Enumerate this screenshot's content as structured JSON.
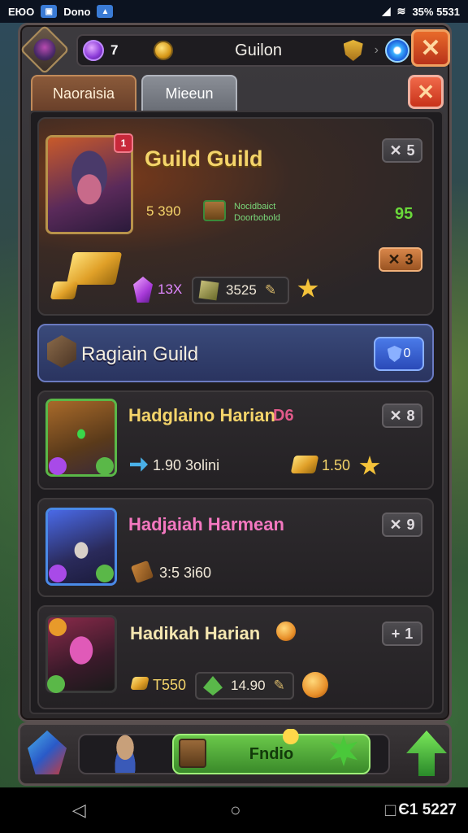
{
  "status_bar": {
    "left_text_1": "ЕЮО",
    "left_text_2": "Dono",
    "right_text": "35% 5531"
  },
  "top_bar": {
    "gem_count": "7",
    "title": "Guilon",
    "separator": "›"
  },
  "tabs": [
    {
      "label": "Naoraisia"
    },
    {
      "label": "Mieeun"
    }
  ],
  "featured_guild": {
    "name": "Guild Guild",
    "badge": "1",
    "gold_stat": "5 390",
    "small_text_line1": "Nocidbaict",
    "small_text_line2": "Doorbobold",
    "green_value": "95",
    "rank_pill": "5",
    "level_pill": "3",
    "gem_amount": "13X",
    "resource_amount": "3525"
  },
  "banner": {
    "title": "Ragiain Guild",
    "button_value": "0"
  },
  "members": [
    {
      "name": "Hadglaino Harian",
      "tag": "D6",
      "stat_1": "1.90 3olini",
      "stat_2": "1.50",
      "rank": "8"
    },
    {
      "name": "Hadjaiah Harmean",
      "stat_1": "3:5 3i60",
      "rank": "9"
    },
    {
      "name": "Hadikah Harian",
      "stat_1": "T550",
      "stat_2": "14.90",
      "rank": "1"
    }
  ],
  "bottom_bar": {
    "action_label": "Fndio"
  },
  "system_nav": {
    "back": "◁",
    "home": "○",
    "recents": "□",
    "time": "Є1 5227"
  },
  "icons": {
    "pill_prefix_x": "✕",
    "pill_prefix_plus": "+",
    "close_glyph": "✕",
    "star_glyph": "★",
    "pencil_glyph": "✎"
  },
  "colors": {
    "gold_title": "#f4d46a",
    "pink_title": "#f478c0",
    "accent_green": "#6ac84a",
    "close_red": "#e86a2a"
  }
}
